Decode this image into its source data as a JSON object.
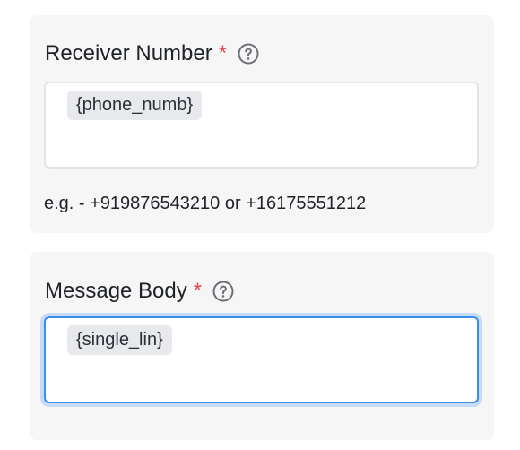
{
  "receiver": {
    "label": "Receiver Number",
    "required_mark": "*",
    "help_icon": "question-circle-icon",
    "token": "{phone_numb}",
    "hint": "e.g. - +919876543210 or +16175551212"
  },
  "message": {
    "label": "Message Body",
    "required_mark": "*",
    "help_icon": "question-circle-icon",
    "token": "{single_lin}",
    "focused": true
  },
  "colors": {
    "required": "#e5484d",
    "focus_border": "#3b8fe8",
    "focus_ring": "#c6dbf8",
    "card_bg": "#f6f6f7",
    "chip_bg": "#e8e9ec"
  }
}
